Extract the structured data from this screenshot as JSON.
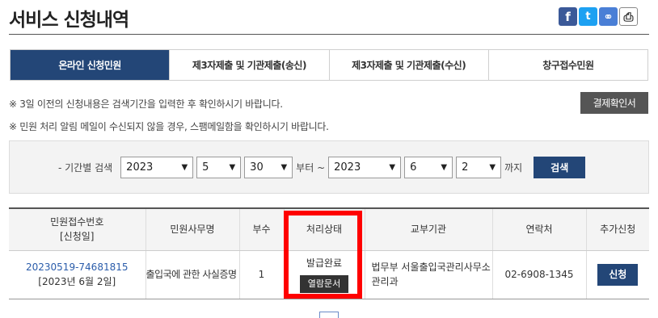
{
  "page": {
    "title": "서비스 신청내역"
  },
  "share": [
    "facebook-icon",
    "twitter-icon",
    "link-icon",
    "print-icon"
  ],
  "tabs": [
    {
      "label": "온라인 신청민원",
      "active": true
    },
    {
      "label": "제3자제출 및 기관제출(송신)",
      "active": false
    },
    {
      "label": "제3자제출 및 기관제출(수신)",
      "active": false
    },
    {
      "label": "창구접수민원",
      "active": false
    }
  ],
  "notices": [
    "※ 3일 이전의 신청내용은 검색기간을 입력한 후 확인하시기 바랍니다.",
    "※ 민원 처리 알림 메일이 수신되지 않을 경우, 스팸메일함을 확인하시기 바랍니다."
  ],
  "payment_button": "결제확인서",
  "search": {
    "label": "- 기간별 검색",
    "from_year": "2023",
    "from_month": "5",
    "from_day": "30",
    "from_text": "부터 ~",
    "to_year": "2023",
    "to_month": "6",
    "to_day": "2",
    "to_text": "까지",
    "button": "검색"
  },
  "table": {
    "headers": {
      "receipt_line1": "민원접수번호",
      "receipt_line2": "[신청일]",
      "service": "민원사무명",
      "copies": "부수",
      "status": "처리상태",
      "issuer": "교부기관",
      "contact": "연락처",
      "extra": "추가신청"
    },
    "rows": [
      {
        "receipt_no": "20230519-74681815",
        "date": "[2023년 6월 2일]",
        "service": "출입국에 관한 사실증명",
        "copies": "1",
        "status": "발급완료",
        "view_doc": "열람문서",
        "issuer": "법무부 서울출입국관리사무소 관리과",
        "contact": "02-6908-1345",
        "apply": "신청"
      }
    ]
  },
  "colors": {
    "navy": "#234677",
    "highlight": "#ff0000",
    "dark_button": "#555555"
  }
}
